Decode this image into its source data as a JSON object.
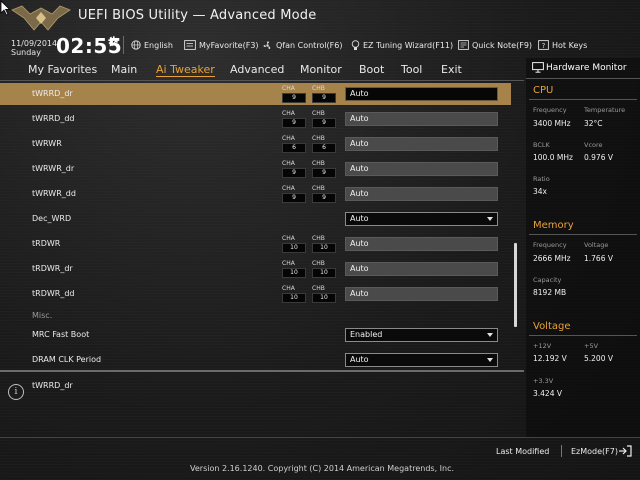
{
  "header": {
    "logo_text": "THE ULTIMATE FORCE",
    "title": "UEFI BIOS Utility — Advanced Mode",
    "date": "11/09/2014",
    "day": "Sunday",
    "time": "02:55",
    "tools": [
      {
        "label": "English",
        "icon": "globe-icon"
      },
      {
        "label": "MyFavorite(F3)",
        "icon": "favorite-icon"
      },
      {
        "label": "Qfan Control(F6)",
        "icon": "fan-icon"
      },
      {
        "label": "EZ Tuning Wizard(F11)",
        "icon": "bulb-icon"
      },
      {
        "label": "Quick Note(F9)",
        "icon": "note-icon"
      },
      {
        "label": "Hot Keys",
        "icon": "help-icon"
      }
    ]
  },
  "menu": {
    "items": [
      "My Favorites",
      "Main",
      "Ai Tweaker",
      "Advanced",
      "Monitor",
      "Boot",
      "Tool",
      "Exit"
    ],
    "active": "Ai Tweaker"
  },
  "settings": {
    "channel_labels": {
      "a": "CHA",
      "b": "CHB"
    },
    "rows": [
      {
        "label": "tWRRD_dr",
        "cha": "9",
        "chb": "9",
        "value": "Auto",
        "kind": "input",
        "selected": true
      },
      {
        "label": "tWRRD_dd",
        "cha": "9",
        "chb": "9",
        "value": "Auto",
        "kind": "input"
      },
      {
        "label": "tWRWR",
        "cha": "6",
        "chb": "6",
        "value": "Auto",
        "kind": "input"
      },
      {
        "label": "tWRWR_dr",
        "cha": "9",
        "chb": "9",
        "value": "Auto",
        "kind": "input"
      },
      {
        "label": "tWRWR_dd",
        "cha": "9",
        "chb": "9",
        "value": "Auto",
        "kind": "input"
      },
      {
        "label": "Dec_WRD",
        "value": "Auto",
        "kind": "select"
      },
      {
        "label": "tRDWR",
        "cha": "10",
        "chb": "10",
        "value": "Auto",
        "kind": "input"
      },
      {
        "label": "tRDWR_dr",
        "cha": "10",
        "chb": "10",
        "value": "Auto",
        "kind": "input"
      },
      {
        "label": "tRDWR_dd",
        "cha": "10",
        "chb": "10",
        "value": "Auto",
        "kind": "input"
      },
      {
        "label": "Misc.",
        "kind": "section"
      },
      {
        "label": "MRC Fast Boot",
        "value": "Enabled",
        "kind": "select"
      },
      {
        "label": "DRAM CLK Period",
        "value": "Auto",
        "kind": "select"
      }
    ]
  },
  "help": {
    "text": "tWRRD_dr"
  },
  "hardware_monitor": {
    "title": "Hardware Monitor",
    "cpu": {
      "title": "CPU",
      "frequency_label": "Frequency",
      "frequency": "3400 MHz",
      "temperature_label": "Temperature",
      "temperature": "32°C",
      "bclk_label": "BCLK",
      "bclk": "100.0 MHz",
      "vcore_label": "Vcore",
      "vcore": "0.976 V",
      "ratio_label": "Ratio",
      "ratio": "34x"
    },
    "memory": {
      "title": "Memory",
      "frequency_label": "Frequency",
      "frequency": "2666 MHz",
      "voltage_label": "Voltage",
      "voltage": "1.766 V",
      "capacity_label": "Capacity",
      "capacity": "8192 MB"
    },
    "voltage": {
      "title": "Voltage",
      "v12_label": "+12V",
      "v12": "12.192 V",
      "v5_label": "+5V",
      "v5": "5.200 V",
      "v33_label": "+3.3V",
      "v33": "3.424 V"
    }
  },
  "footer": {
    "last_modified": "Last Modified",
    "ezmode": "EzMode(F7)",
    "copyright": "Version 2.16.1240. Copyright (C) 2014 American Megatrends, Inc."
  },
  "colors": {
    "accent": "#e8a13a",
    "selected_row": "#a7834c",
    "background": "#1c1c1c"
  }
}
